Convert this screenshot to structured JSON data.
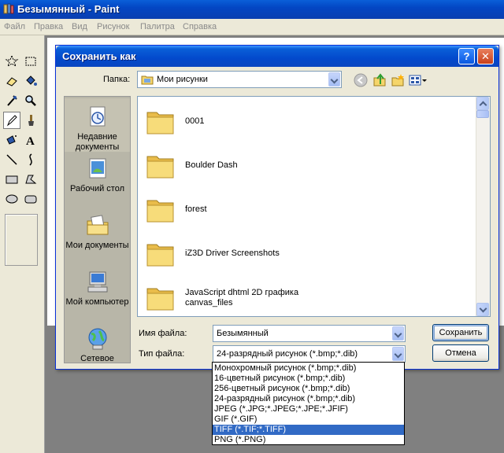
{
  "app": {
    "title": "Безымянный - Paint",
    "menu": [
      "Файл",
      "Правка",
      "Вид",
      "Рисунок",
      "Палитра",
      "Справка"
    ]
  },
  "dialog": {
    "title": "Сохранить как",
    "help_glyph": "?",
    "close_glyph": "✕",
    "folder_label": "Папка:",
    "folder_value": "Мои рисунки",
    "places": [
      {
        "label": "Недавние документы",
        "icon": "recent-documents-icon"
      },
      {
        "label": "Рабочий стол",
        "icon": "desktop-icon"
      },
      {
        "label": "Мои документы",
        "icon": "my-documents-icon"
      },
      {
        "label": "Мой компьютер",
        "icon": "my-computer-icon"
      },
      {
        "label": "Сетевое",
        "icon": "network-icon"
      }
    ],
    "files": [
      {
        "name": "0001"
      },
      {
        "name": "Boulder Dash"
      },
      {
        "name": "forest"
      },
      {
        "name": "iZ3D Driver Screenshots"
      },
      {
        "name": "JavaScript dhtml 2D графика canvas_files"
      }
    ],
    "file_name_label": "Имя файла:",
    "file_name_value": "Безымянный",
    "file_type_label": "Тип файла:",
    "file_type_value": "24-разрядный рисунок (*.bmp;*.dib)",
    "save_label": "Сохранить",
    "cancel_label": "Отмена",
    "file_type_options": [
      "Монохромный рисунок (*.bmp;*.dib)",
      "16-цветный рисунок (*.bmp;*.dib)",
      "256-цветный рисунок (*.bmp;*.dib)",
      "24-разрядный рисунок (*.bmp;*.dib)",
      "JPEG (*.JPG;*.JPEG;*.JPE;*.JFIF)",
      "GIF (*.GIF)",
      "TIFF (*.TIF;*.TIFF)",
      "PNG (*.PNG)"
    ],
    "highlighted_option": "TIFF (*.TIF;*.TIFF)"
  },
  "colors": {
    "titlebar": "#0a5fd8",
    "dialog_bg": "#ece9d8",
    "highlight": "#316ac5",
    "folder": "#f5d56a"
  }
}
